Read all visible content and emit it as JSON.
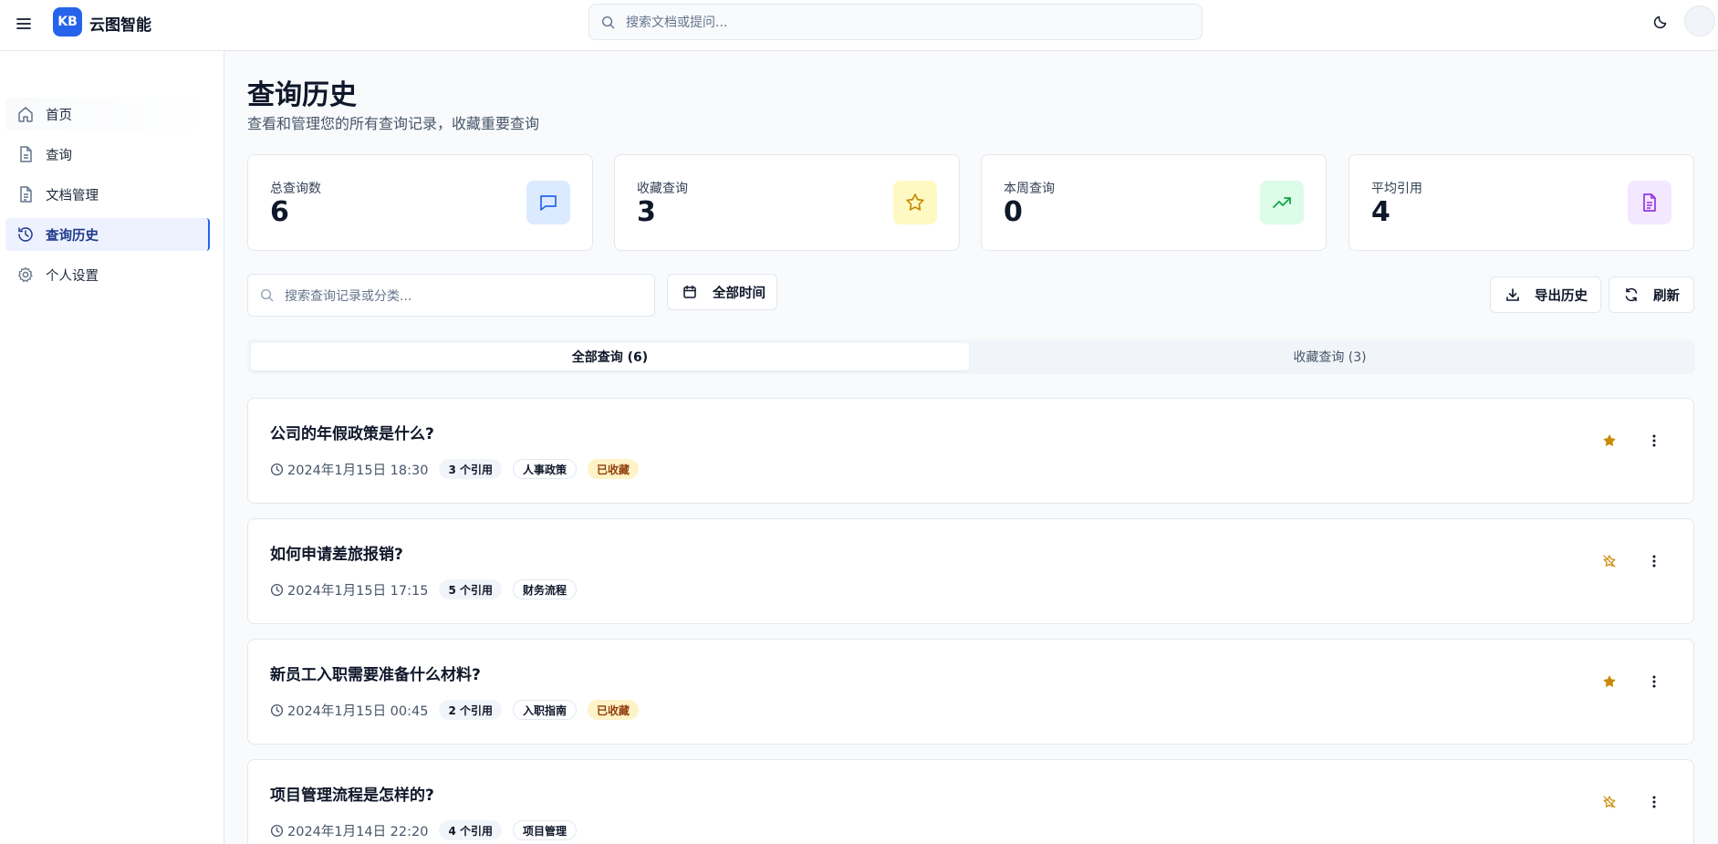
{
  "header": {
    "logo_text": "KB",
    "app_name": "云图智能",
    "search_placeholder": "搜索文档或提问..."
  },
  "sidebar": {
    "items": [
      {
        "label": "首页",
        "icon": "home-icon"
      },
      {
        "label": "查询",
        "icon": "file-icon"
      },
      {
        "label": "文档管理",
        "icon": "file-text-icon"
      },
      {
        "label": "查询历史",
        "icon": "history-icon",
        "active": true
      },
      {
        "label": "个人设置",
        "icon": "gear-icon"
      }
    ]
  },
  "page": {
    "title": "查询历史",
    "subtitle": "查看和管理您的所有查询记录，收藏重要查询"
  },
  "stats": [
    {
      "label": "总查询数",
      "value": "6",
      "icon": "message-square-icon",
      "color": "#2563eb",
      "bg": "#dbeafe"
    },
    {
      "label": "收藏查询",
      "value": "3",
      "icon": "star-icon",
      "color": "#ca8a04",
      "bg": "#fef9c3"
    },
    {
      "label": "本周查询",
      "value": "0",
      "icon": "trending-up-icon",
      "color": "#16a34a",
      "bg": "#dcfce7"
    },
    {
      "label": "平均引用",
      "value": "4",
      "icon": "file-text-icon",
      "color": "#9333ea",
      "bg": "#f3e8ff"
    }
  ],
  "filters": {
    "search_placeholder": "搜索查询记录或分类...",
    "time_label": "全部时间",
    "export_label": "导出历史",
    "refresh_label": "刷新"
  },
  "tabs": {
    "all": "全部查询 (6)",
    "favorites": "收藏查询 (3)"
  },
  "queries": [
    {
      "title": "公司的年假政策是什么?",
      "time": "2024年1月15日 18:30",
      "citations": "3 个引用",
      "category": "人事政策",
      "favorited": true,
      "fav_label": "已收藏"
    },
    {
      "title": "如何申请差旅报销?",
      "time": "2024年1月15日 17:15",
      "citations": "5 个引用",
      "category": "财务流程",
      "favorited": false
    },
    {
      "title": "新员工入职需要准备什么材料?",
      "time": "2024年1月15日 00:45",
      "citations": "2 个引用",
      "category": "入职指南",
      "favorited": true,
      "fav_label": "已收藏"
    },
    {
      "title": "项目管理流程是怎样的?",
      "time": "2024年1月14日 22:20",
      "citations": "4 个引用",
      "category": "项目管理",
      "favorited": false
    }
  ]
}
